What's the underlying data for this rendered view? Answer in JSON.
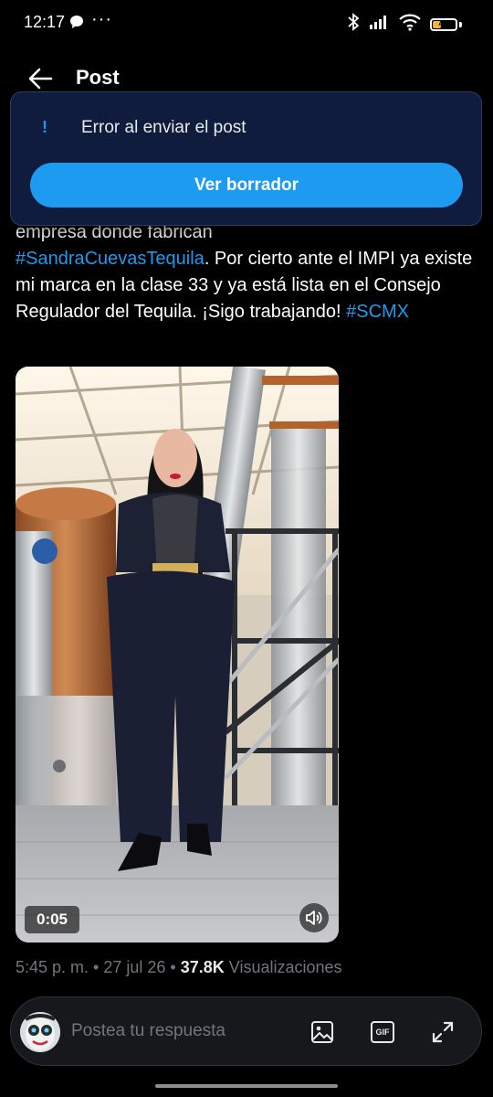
{
  "status_bar": {
    "time": "12:17",
    "battery_level": "43"
  },
  "header": {
    "title": "Post"
  },
  "toast": {
    "icon": "!",
    "message": "Error al enviar el post",
    "button_label": "Ver borrador"
  },
  "tweet": {
    "line1": "empresa donde fabrican",
    "hashtag1": "#SandraCuevasTequila",
    "body": ". Por cierto ante el IMPI ya existe mi marca en la clase 33 y ya está lista en el Consejo Regulador del Tequila. ¡Sigo trabajando! ",
    "hashtag2": "#SCMX"
  },
  "video": {
    "duration": "0:05"
  },
  "meta": {
    "time": "5:45 p. m.",
    "sep1": " • ",
    "date": "27 jul 26",
    "sep2": " • ",
    "views_count": "37.8K",
    "views_label": " Visualizaciones"
  },
  "reply": {
    "placeholder": "Postea tu respuesta",
    "gif_label": "GIF"
  },
  "colors": {
    "accent": "#1d9bf0",
    "background": "#000000",
    "toast_bg": "#0f1c3d",
    "muted": "#71767b",
    "battery": "#f5b731"
  }
}
